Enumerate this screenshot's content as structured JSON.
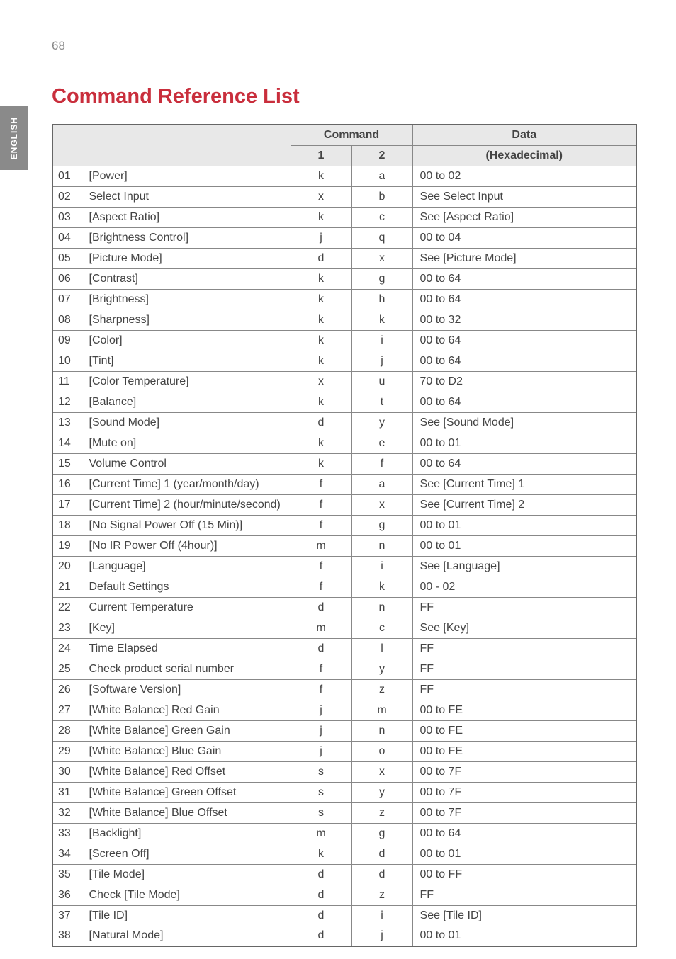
{
  "page_number": "68",
  "side_tab": "ENGLISH",
  "title": "Command Reference List",
  "headers": {
    "command": "Command",
    "data": "Data",
    "cmd1": "1",
    "cmd2": "2",
    "hex": "(Hexadecimal)"
  },
  "rows": [
    {
      "n": "01",
      "name": "[Power]",
      "c1": "k",
      "c2": "a",
      "d": "00 to 02"
    },
    {
      "n": "02",
      "name": "Select Input",
      "c1": "x",
      "c2": "b",
      "d": "See Select Input"
    },
    {
      "n": "03",
      "name": "[Aspect Ratio]",
      "c1": "k",
      "c2": "c",
      "d": "See [Aspect Ratio]"
    },
    {
      "n": "04",
      "name": "[Brightness Control]",
      "c1": "j",
      "c2": "q",
      "d": "00 to 04"
    },
    {
      "n": "05",
      "name": "[Picture Mode]",
      "c1": "d",
      "c2": "x",
      "d": "See [Picture Mode]"
    },
    {
      "n": "06",
      "name": "[Contrast]",
      "c1": "k",
      "c2": "g",
      "d": "00 to 64"
    },
    {
      "n": "07",
      "name": "[Brightness]",
      "c1": "k",
      "c2": "h",
      "d": "00 to 64"
    },
    {
      "n": "08",
      "name": "[Sharpness]",
      "c1": "k",
      "c2": "k",
      "d": "00 to 32"
    },
    {
      "n": "09",
      "name": "[Color]",
      "c1": "k",
      "c2": "i",
      "d": "00 to 64"
    },
    {
      "n": "10",
      "name": "[Tint]",
      "c1": "k",
      "c2": "j",
      "d": "00 to 64"
    },
    {
      "n": "11",
      "name": "[Color Temperature]",
      "c1": "x",
      "c2": "u",
      "d": "70 to D2"
    },
    {
      "n": "12",
      "name": "[Balance]",
      "c1": "k",
      "c2": "t",
      "d": "00 to 64"
    },
    {
      "n": "13",
      "name": "[Sound Mode]",
      "c1": "d",
      "c2": "y",
      "d": "See [Sound Mode]"
    },
    {
      "n": "14",
      "name": "[Mute on]",
      "c1": "k",
      "c2": "e",
      "d": "00 to 01"
    },
    {
      "n": "15",
      "name": "Volume Control",
      "c1": "k",
      "c2": "f",
      "d": "00 to 64"
    },
    {
      "n": "16",
      "name": "[Current Time] 1 (year/month/day)",
      "c1": "f",
      "c2": "a",
      "d": "See [Current Time] 1"
    },
    {
      "n": "17",
      "name": "[Current Time] 2 (hour/minute/second)",
      "c1": "f",
      "c2": "x",
      "d": "See [Current Time] 2"
    },
    {
      "n": "18",
      "name": "[No Signal Power Off (15 Min)]",
      "c1": "f",
      "c2": "g",
      "d": "00 to 01"
    },
    {
      "n": "19",
      "name": "[No IR Power Off (4hour)]",
      "c1": "m",
      "c2": "n",
      "d": "00 to 01"
    },
    {
      "n": "20",
      "name": "[Language]",
      "c1": "f",
      "c2": "i",
      "d": "See [Language]"
    },
    {
      "n": "21",
      "name": "Default Settings",
      "c1": "f",
      "c2": "k",
      "d": "00 - 02"
    },
    {
      "n": "22",
      "name": "Current Temperature",
      "c1": "d",
      "c2": "n",
      "d": "FF"
    },
    {
      "n": "23",
      "name": "[Key]",
      "c1": "m",
      "c2": "c",
      "d": "See [Key]"
    },
    {
      "n": "24",
      "name": "Time Elapsed",
      "c1": "d",
      "c2": "l",
      "d": "FF"
    },
    {
      "n": "25",
      "name": "Check product serial number",
      "c1": "f",
      "c2": "y",
      "d": "FF"
    },
    {
      "n": "26",
      "name": "[Software Version]",
      "c1": "f",
      "c2": "z",
      "d": "FF"
    },
    {
      "n": "27",
      "name": "[White Balance] Red Gain",
      "c1": "j",
      "c2": "m",
      "d": "00 to FE"
    },
    {
      "n": "28",
      "name": "[White Balance] Green Gain",
      "c1": "j",
      "c2": "n",
      "d": "00 to FE"
    },
    {
      "n": "29",
      "name": "[White Balance] Blue Gain",
      "c1": "j",
      "c2": "o",
      "d": "00 to FE"
    },
    {
      "n": "30",
      "name": "[White Balance] Red Offset",
      "c1": "s",
      "c2": "x",
      "d": "00 to 7F"
    },
    {
      "n": "31",
      "name": "[White Balance] Green Offset",
      "c1": "s",
      "c2": "y",
      "d": "00 to 7F"
    },
    {
      "n": "32",
      "name": "[White Balance] Blue Offset",
      "c1": "s",
      "c2": "z",
      "d": "00 to 7F"
    },
    {
      "n": "33",
      "name": "[Backlight]",
      "c1": "m",
      "c2": "g",
      "d": "00 to 64"
    },
    {
      "n": "34",
      "name": "[Screen Off]",
      "c1": "k",
      "c2": "d",
      "d": "00 to 01"
    },
    {
      "n": "35",
      "name": "[Tile Mode]",
      "c1": "d",
      "c2": "d",
      "d": "00 to FF"
    },
    {
      "n": "36",
      "name": "Check [Tile Mode]",
      "c1": "d",
      "c2": "z",
      "d": "FF"
    },
    {
      "n": "37",
      "name": "[Tile ID]",
      "c1": "d",
      "c2": "i",
      "d": "See [Tile ID]"
    },
    {
      "n": "38",
      "name": "[Natural Mode]",
      "c1": "d",
      "c2": "j",
      "d": "00 to 01"
    }
  ]
}
